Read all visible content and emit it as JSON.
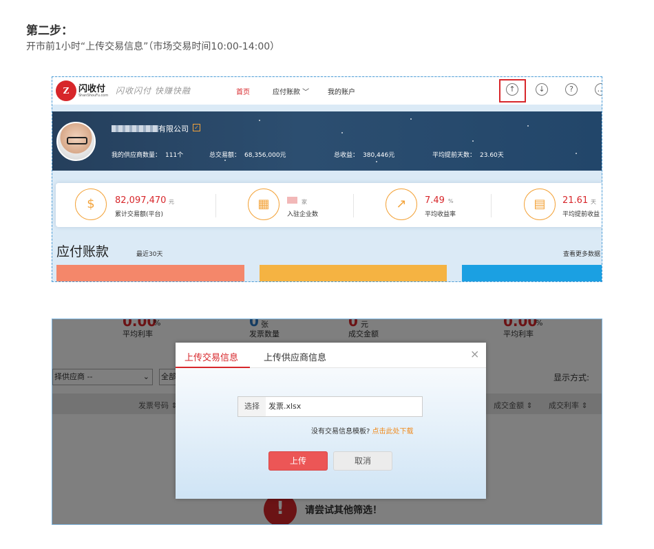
{
  "step": {
    "title": "第二步：",
    "desc": "开市前1小时“上传交易信息”（市场交易时间10:00-14:00）"
  },
  "screen1": {
    "logo": {
      "mark": "Z",
      "name": "闪收付",
      "sub": "ShanShouFu.com",
      "slogan": "闪收闪付 快赚快融"
    },
    "nav": [
      "首页",
      "应付账款 ﹀",
      "我的账户"
    ],
    "icons": [
      "upload-icon",
      "download-icon",
      "help-icon",
      "more-icon"
    ],
    "icon_glyphs": [
      "↑",
      "↓",
      "?",
      "…"
    ],
    "banner": {
      "company_suffix": "有限公司",
      "verify_mark": "✓",
      "stats": [
        {
          "label": "我的供应商数量：",
          "value": "111个"
        },
        {
          "label": "总交易额：",
          "value": "68,356,000元"
        },
        {
          "label": "总收益：",
          "value": "380,446元"
        },
        {
          "label": "平均提前天数：",
          "value": "23.60天"
        }
      ]
    },
    "cards": [
      {
        "icon": "coins-icon",
        "glyph": "$",
        "value": "82,097,470",
        "unit": "元",
        "label": "累计交易额(平台)"
      },
      {
        "icon": "building-icon",
        "glyph": "▦",
        "value": "",
        "unit": "家",
        "label": "入驻企业数"
      },
      {
        "icon": "chart-icon",
        "glyph": "↗",
        "value": "7.49",
        "unit": "%",
        "label": "平均收益率"
      },
      {
        "icon": "calendar-icon",
        "glyph": "▤",
        "value": "21.61",
        "unit": "天",
        "label": "平均提前收益"
      }
    ],
    "section_title": "应付账款",
    "section_sub": "最近30天",
    "more_link": "查看更多数据",
    "bar_colors": [
      "#f4876a",
      "#f5b342",
      "#1ba0e2"
    ]
  },
  "screen2": {
    "bg_stats": [
      {
        "value": "0.00",
        "unit": "%",
        "label": "平均利率"
      },
      {
        "value": "0",
        "unit": "张",
        "label": "发票数量"
      },
      {
        "value": "0",
        "unit": "元",
        "label": "成交金额"
      },
      {
        "value": "0.00",
        "unit": "%",
        "label": "平均利率"
      }
    ],
    "filter_supplier": "择供应商 --",
    "filter_all": "全部",
    "display_mode": "显示方式:",
    "table_headers": [
      "发票号码",
      "成交金额",
      "成交利率"
    ],
    "no_result": "请尝试其他筛选！",
    "modal": {
      "tabs": [
        "上传交易信息",
        "上传供应商信息"
      ],
      "close": "×",
      "choose": "选择",
      "file_value": "发票.xlsx",
      "template_note": "没有交易信息模板?",
      "template_link": "点击此处下载",
      "upload": "上传",
      "cancel": "取消"
    }
  }
}
